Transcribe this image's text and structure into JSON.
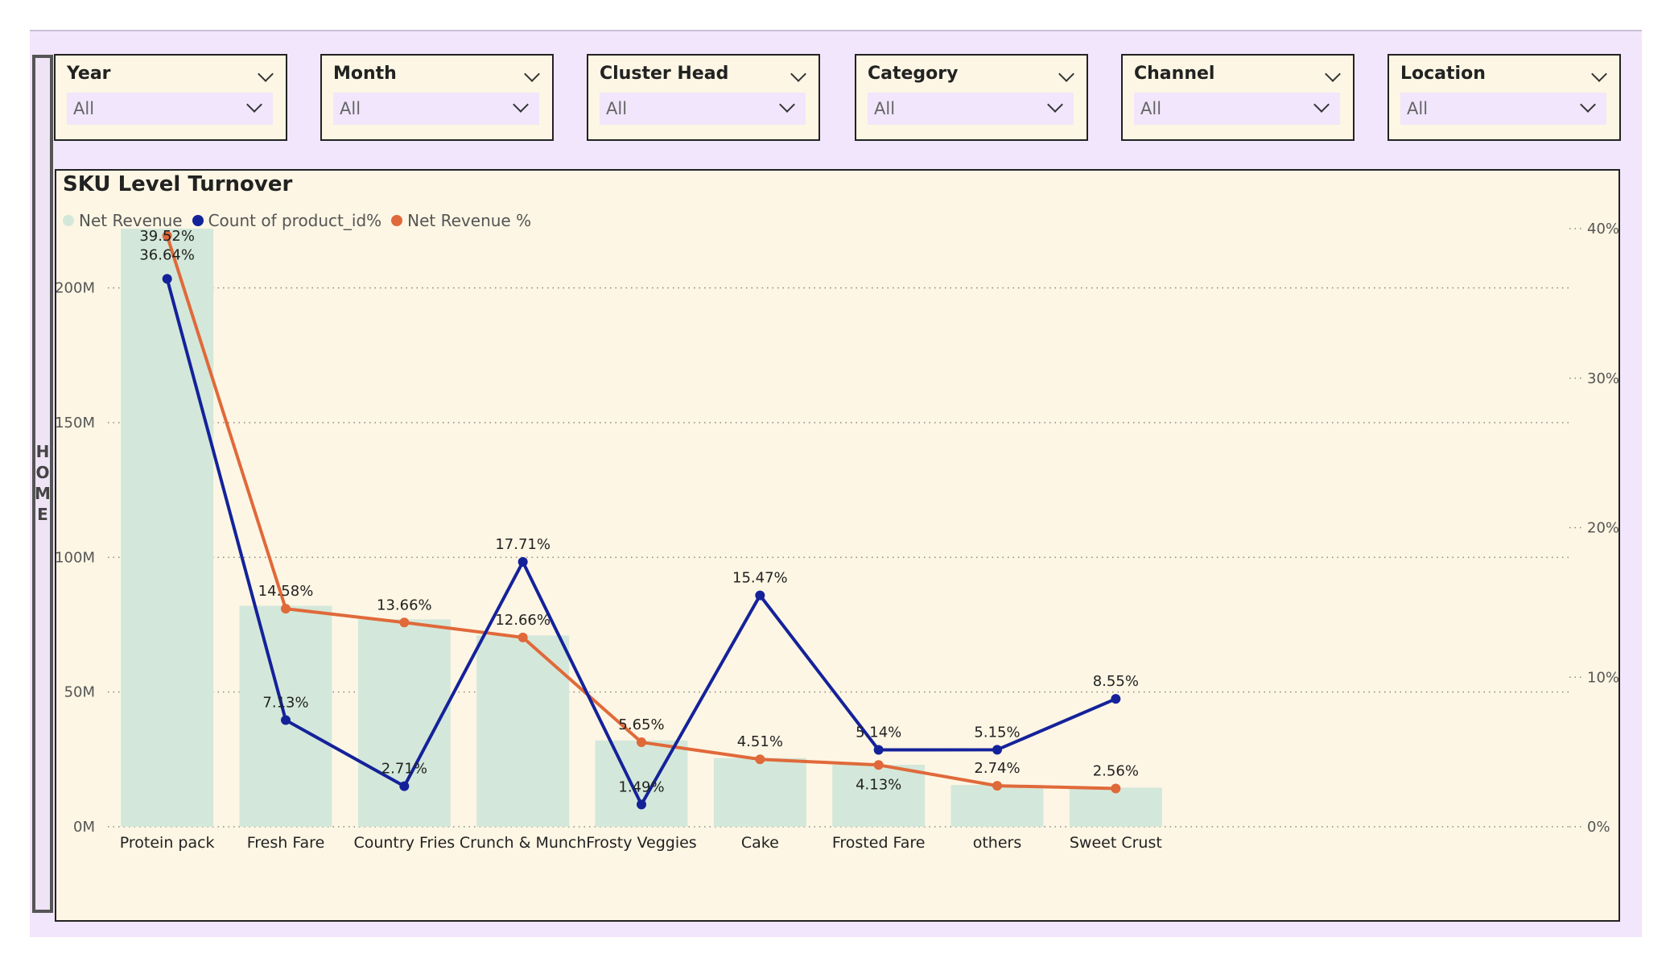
{
  "home": {
    "label": "HOME"
  },
  "slicers": [
    {
      "title": "Year",
      "value": "All"
    },
    {
      "title": "Month",
      "value": "All"
    },
    {
      "title": "Cluster Head",
      "value": "All"
    },
    {
      "title": "Category",
      "value": "All"
    },
    {
      "title": "Channel",
      "value": "All"
    },
    {
      "title": "Location",
      "value": "All"
    }
  ],
  "colors": {
    "bar": "#d3e8da",
    "count": "#14229a",
    "revenue": "#e0693a"
  },
  "chart_data": {
    "type": "bar",
    "title": "SKU Level Turnover",
    "categories": [
      "Protein pack",
      "Fresh Fare",
      "Country Fries",
      "Crunch & Munch",
      "Frosty Veggies",
      "Cake",
      "Frosted Fare",
      "others",
      "Sweet Crust"
    ],
    "series": [
      {
        "name": "Net Revenue",
        "type": "bar",
        "axis": "left",
        "values": [
          222,
          82,
          77,
          71,
          32,
          25.5,
          23,
          15.5,
          14.5
        ]
      },
      {
        "name": "Count of product_id%",
        "type": "line",
        "axis": "right",
        "values": [
          36.64,
          7.13,
          2.71,
          17.71,
          1.49,
          15.47,
          5.14,
          5.15,
          8.55
        ],
        "labels": [
          "36.64%",
          "7.13%",
          "2.71%",
          "17.71%",
          "1.49%",
          "15.47%",
          "5.14%",
          "5.15%",
          "8.55%"
        ]
      },
      {
        "name": "Net Revenue %",
        "type": "line",
        "axis": "right",
        "values": [
          39.52,
          14.58,
          13.66,
          12.66,
          5.65,
          4.51,
          4.13,
          2.74,
          2.56
        ],
        "labels": [
          "39.52%",
          "14.58%",
          "13.66%",
          "12.66%",
          "5.65%",
          "4.51%",
          "4.13%",
          "2.74%",
          "2.56%"
        ]
      }
    ],
    "left_axis": {
      "ticks": [
        "0M",
        "50M",
        "100M",
        "150M",
        "200M"
      ],
      "tick_values": [
        0,
        50,
        100,
        150,
        200
      ],
      "range": [
        0,
        222
      ]
    },
    "right_axis": {
      "ticks": [
        "0%",
        "10%",
        "20%",
        "30%",
        "40%"
      ],
      "tick_values": [
        0,
        10,
        20,
        30,
        40
      ],
      "range": [
        0,
        40
      ]
    },
    "grid": true,
    "legend": "top-left"
  }
}
